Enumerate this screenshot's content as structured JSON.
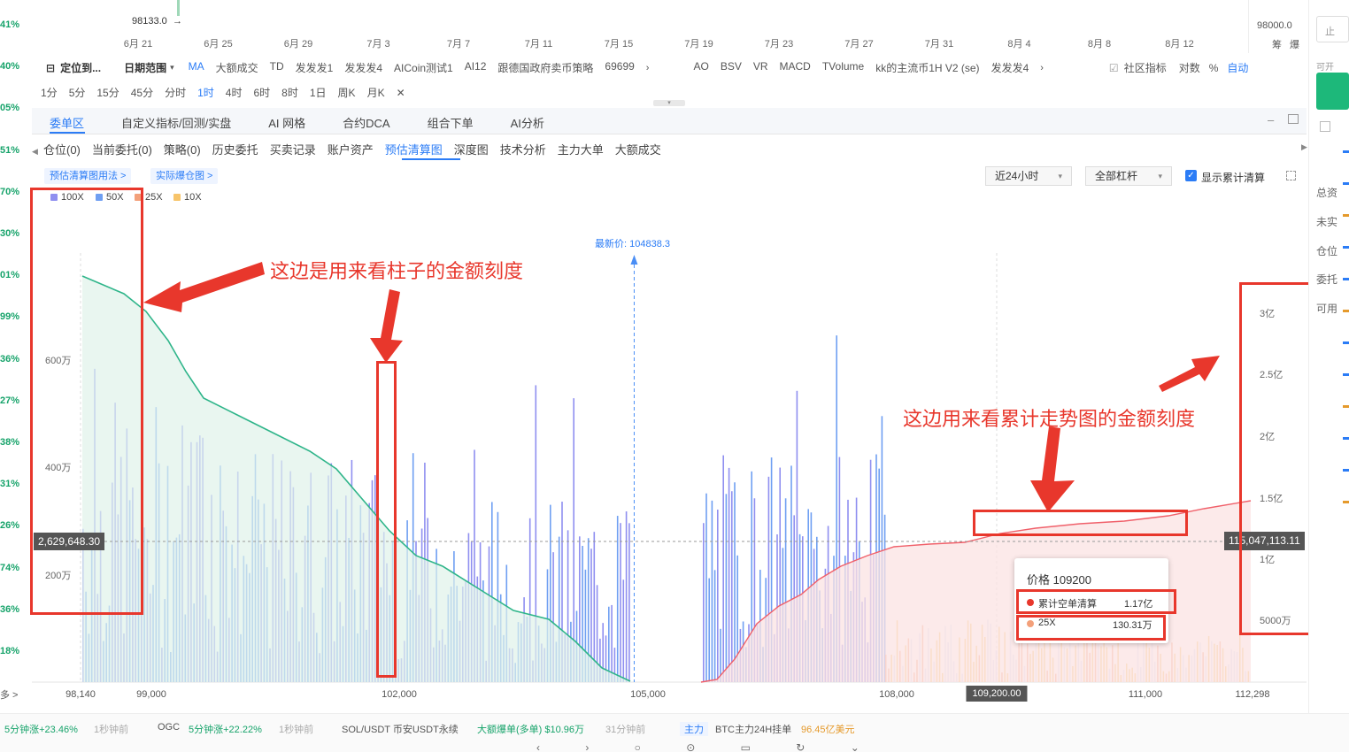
{
  "left_strip": [
    "41%",
    "40%",
    "05%",
    "51%",
    "70%",
    "30%",
    "01%",
    "99%",
    "36%",
    "27%",
    "38%",
    "31%",
    "26%",
    "74%",
    "36%",
    "18%",
    "多 >"
  ],
  "top_price_label": "98133.0",
  "top_right_price": "98000.0",
  "top_right_labels": {
    "chip": "筹",
    "blast": "爆"
  },
  "date_axis": [
    "6月 21",
    "6月 25",
    "6月 29",
    "7月 3",
    "7月 7",
    "7月 11",
    "7月 15",
    "7月 19",
    "7月 23",
    "7月 27",
    "7月 31",
    "8月 4",
    "8月 8",
    "8月 12"
  ],
  "toolbar": {
    "locate": "定位到...",
    "date_range": "日期范围",
    "indicators": [
      "MA",
      "大额成交",
      "TD",
      "发发发1",
      "发发发4",
      "AICoin测试1",
      "AI12",
      "跟德国政府卖币策略",
      "69699"
    ],
    "indicators2": [
      "AO",
      "BSV",
      "VR",
      "MACD",
      "TVolume",
      "kk的主流币1H V2 (se)",
      "发发发4"
    ],
    "community": "社区指标",
    "log": "对数",
    "pct": "%",
    "auto": "自动"
  },
  "intervals": [
    "1分",
    "5分",
    "15分",
    "45分",
    "分时",
    "1时",
    "4时",
    "6时",
    "8时",
    "1日",
    "周K",
    "月K"
  ],
  "active_interval": "1时",
  "main_tabs": [
    "委单区",
    "自定义指标/回测/实盘",
    "AI 网格",
    "合约DCA",
    "组合下单",
    "AI分析"
  ],
  "sub_tabs": [
    "仓位(0)",
    "当前委托(0)",
    "策略(0)",
    "历史委托",
    "买卖记录",
    "账户资产",
    "预估清算图",
    "深度图",
    "技术分析",
    "主力大单",
    "大额成交"
  ],
  "pills": [
    "预估清算图用法 >",
    "实际爆仓图 >"
  ],
  "range_select": "近24小时",
  "leverage_select": "全部杠杆",
  "show_cumulative": "显示累计清算",
  "legend": [
    {
      "name": "100X",
      "color": "#8f8ff0"
    },
    {
      "name": "50X",
      "color": "#6f9ff2"
    },
    {
      "name": "25X",
      "color": "#f3a07a"
    },
    {
      "name": "10X",
      "color": "#f7c46a"
    }
  ],
  "right_panel": [
    "止",
    "可开",
    "总资",
    "未实",
    "仓位",
    "委托",
    "可用"
  ],
  "chart_data": {
    "type": "bar",
    "latest_price_label": "最新价: 104838.3",
    "latest_price": 104838.3,
    "x_range": [
      98140,
      112298
    ],
    "x_ticks": [
      "98,140",
      "99,000",
      "102,000",
      "105,000",
      "108,000",
      "109,200.00",
      "111,000",
      "112,298"
    ],
    "left_ticks": [
      "600万",
      "400万",
      "200万"
    ],
    "right_ticks": [
      "3亿",
      "2.5亿",
      "2亿",
      "1.5亿",
      "1亿",
      "5000万"
    ],
    "crosshair_left_label": "2,629,648.30",
    "crosshair_right_label": "115,047,113.11",
    "tooltip": {
      "price": "价格 109200",
      "cum_label": "累计空单清算",
      "cum_value": "1.17亿",
      "lev_label": "25X",
      "lev_value": "130.31万"
    }
  },
  "annotations": {
    "left": "这边是用来看柱子的金额刻度",
    "right": "这边用来看累计走势图的金额刻度"
  },
  "ticker": [
    {
      "t": "5分钟涨+23.46%",
      "c": "g"
    },
    {
      "t": "1秒钟前",
      "c": "gr"
    },
    {
      "t": "OGC",
      "c": ""
    },
    {
      "t": "5分钟涨+22.22%",
      "c": "g"
    },
    {
      "t": "1秒钟前",
      "c": "gr"
    },
    {
      "t": "SOL/USDT 币安USDT永续",
      "c": ""
    },
    {
      "t": "大额爆单(多单) $10.96万",
      "c": "g"
    },
    {
      "t": "31分钟前",
      "c": "gr"
    },
    {
      "t": "主力",
      "c": "bl"
    },
    {
      "t": "BTC主力24H挂单",
      "c": ""
    },
    {
      "t": "96.45亿美元",
      "c": "o"
    }
  ]
}
